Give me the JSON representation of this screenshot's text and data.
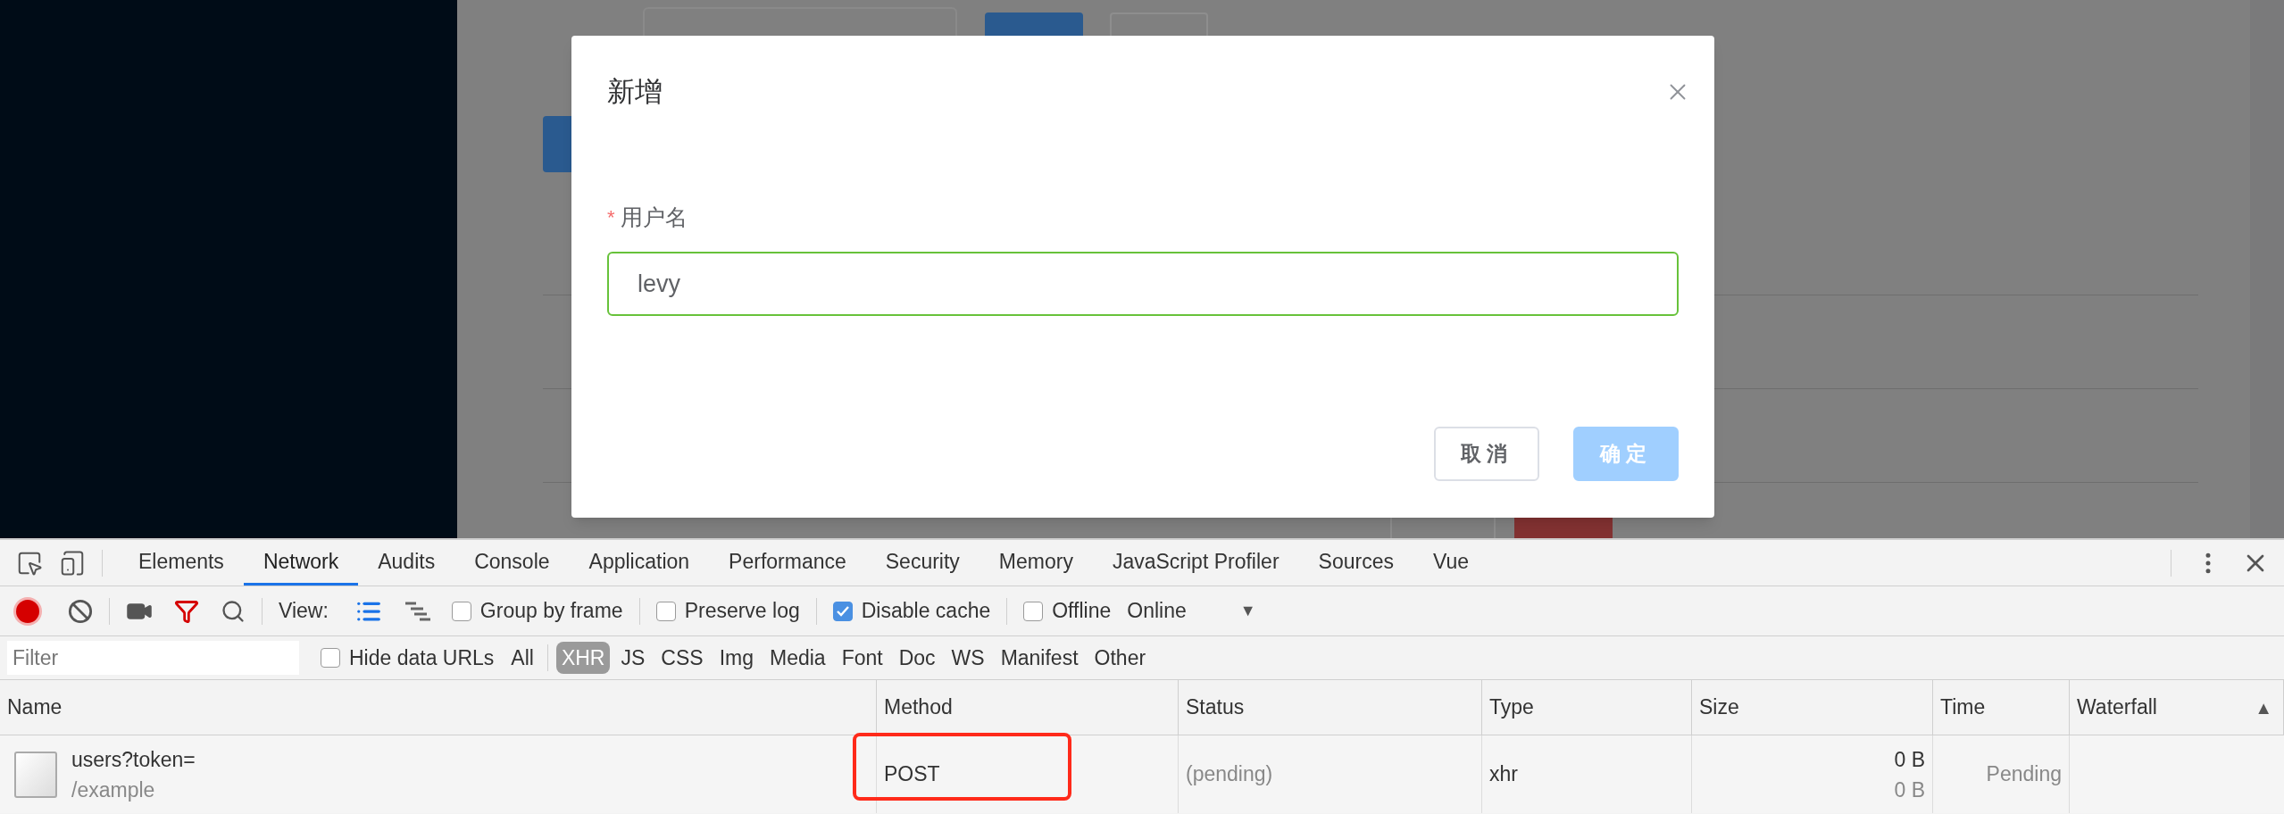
{
  "modal": {
    "title": "新增",
    "field": {
      "label": "用户名",
      "required_mark": "*",
      "value": "levy"
    },
    "buttons": [
      {
        "label": "取消",
        "kind": "default",
        "disabled": false
      },
      {
        "label": "确定",
        "kind": "primary",
        "disabled": true
      }
    ]
  },
  "devtools": {
    "tabs": [
      {
        "label": "Elements",
        "selected": false
      },
      {
        "label": "Network",
        "selected": true
      },
      {
        "label": "Audits",
        "selected": false
      },
      {
        "label": "Console",
        "selected": false
      },
      {
        "label": "Application",
        "selected": false
      },
      {
        "label": "Performance",
        "selected": false
      },
      {
        "label": "Security",
        "selected": false
      },
      {
        "label": "Memory",
        "selected": false
      },
      {
        "label": "JavaScript Profiler",
        "selected": false
      },
      {
        "label": "Sources",
        "selected": false
      },
      {
        "label": "Vue",
        "selected": false
      }
    ],
    "toolbar": {
      "recording": true,
      "view_label": "View:",
      "options": [
        {
          "label": "Group by frame",
          "checked": false
        },
        {
          "label": "Preserve log",
          "checked": false
        },
        {
          "label": "Disable cache",
          "checked": true
        },
        {
          "label": "Offline",
          "checked": false
        }
      ],
      "throttle": "Online",
      "throttle_arrow": "▼"
    },
    "filter": {
      "placeholder": "Filter",
      "hide_data_urls": {
        "label": "Hide data URLs",
        "checked": false
      },
      "types": [
        {
          "label": "All",
          "selected": false
        },
        {
          "label": "XHR",
          "selected": true
        },
        {
          "label": "JS",
          "selected": false
        },
        {
          "label": "CSS",
          "selected": false
        },
        {
          "label": "Img",
          "selected": false
        },
        {
          "label": "Media",
          "selected": false
        },
        {
          "label": "Font",
          "selected": false
        },
        {
          "label": "Doc",
          "selected": false
        },
        {
          "label": "WS",
          "selected": false
        },
        {
          "label": "Manifest",
          "selected": false
        },
        {
          "label": "Other",
          "selected": false
        }
      ]
    },
    "table": {
      "columns": [
        "Name",
        "Method",
        "Status",
        "Type",
        "Size",
        "Time",
        "Waterfall"
      ],
      "sort_mark": "▲",
      "rows": [
        {
          "name": "users?token=",
          "path": "/example",
          "method": "POST",
          "status": "(pending)",
          "type": "xhr",
          "size": "0 B",
          "content": "0 B",
          "time": "Pending",
          "highlighted": true
        }
      ]
    }
  }
}
